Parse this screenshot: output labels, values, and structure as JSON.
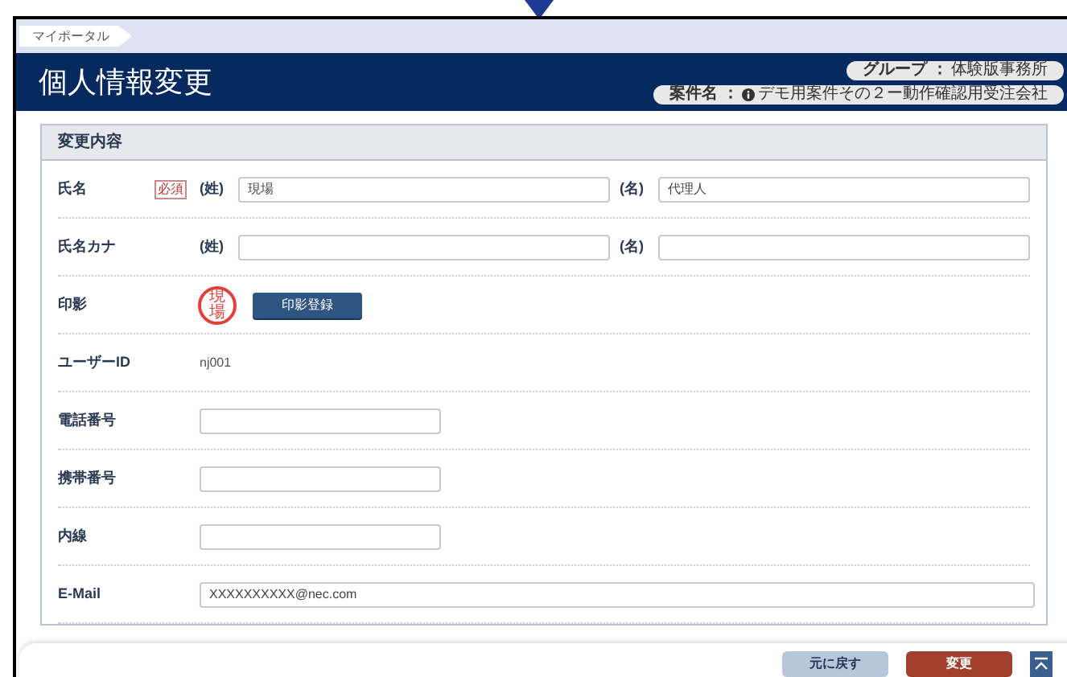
{
  "breadcrumb": [
    "マイポータル"
  ],
  "header": {
    "title": "個人情報変更",
    "group_label": "グループ ：",
    "group_value": "体験版事務所",
    "project_label": "案件名 ：",
    "project_value": "デモ用案件その２ー動作確認用受注会社"
  },
  "section": {
    "title": "変更内容"
  },
  "rows": [
    {
      "kind": "pair",
      "label": "氏名",
      "required": true,
      "required_label": "必須",
      "fields": [
        {
          "label": "(姓)",
          "value": "現場"
        },
        {
          "label": "(名)",
          "value": "代理人"
        }
      ]
    },
    {
      "kind": "pair",
      "label": "氏名カナ",
      "required": false,
      "fields": [
        {
          "label": "(姓)"
        },
        {
          "label": "(名)"
        }
      ]
    },
    {
      "kind": "stamp",
      "label": "印影",
      "stamp": "現場",
      "button": "印影登録"
    },
    {
      "kind": "text",
      "label": "ユーザーID",
      "value": "nj001"
    },
    {
      "kind": "input",
      "label": "電話番号"
    },
    {
      "kind": "input",
      "label": "携帯番号"
    },
    {
      "kind": "input",
      "label": "内線"
    },
    {
      "kind": "wide",
      "label": "E-Mail",
      "value": "XXXXXXXXXX@nec.com"
    }
  ],
  "footer": {
    "buttons": [
      {
        "label": "元に戻す",
        "kind": "secondary"
      },
      {
        "label": "変更",
        "kind": "primary"
      }
    ]
  }
}
